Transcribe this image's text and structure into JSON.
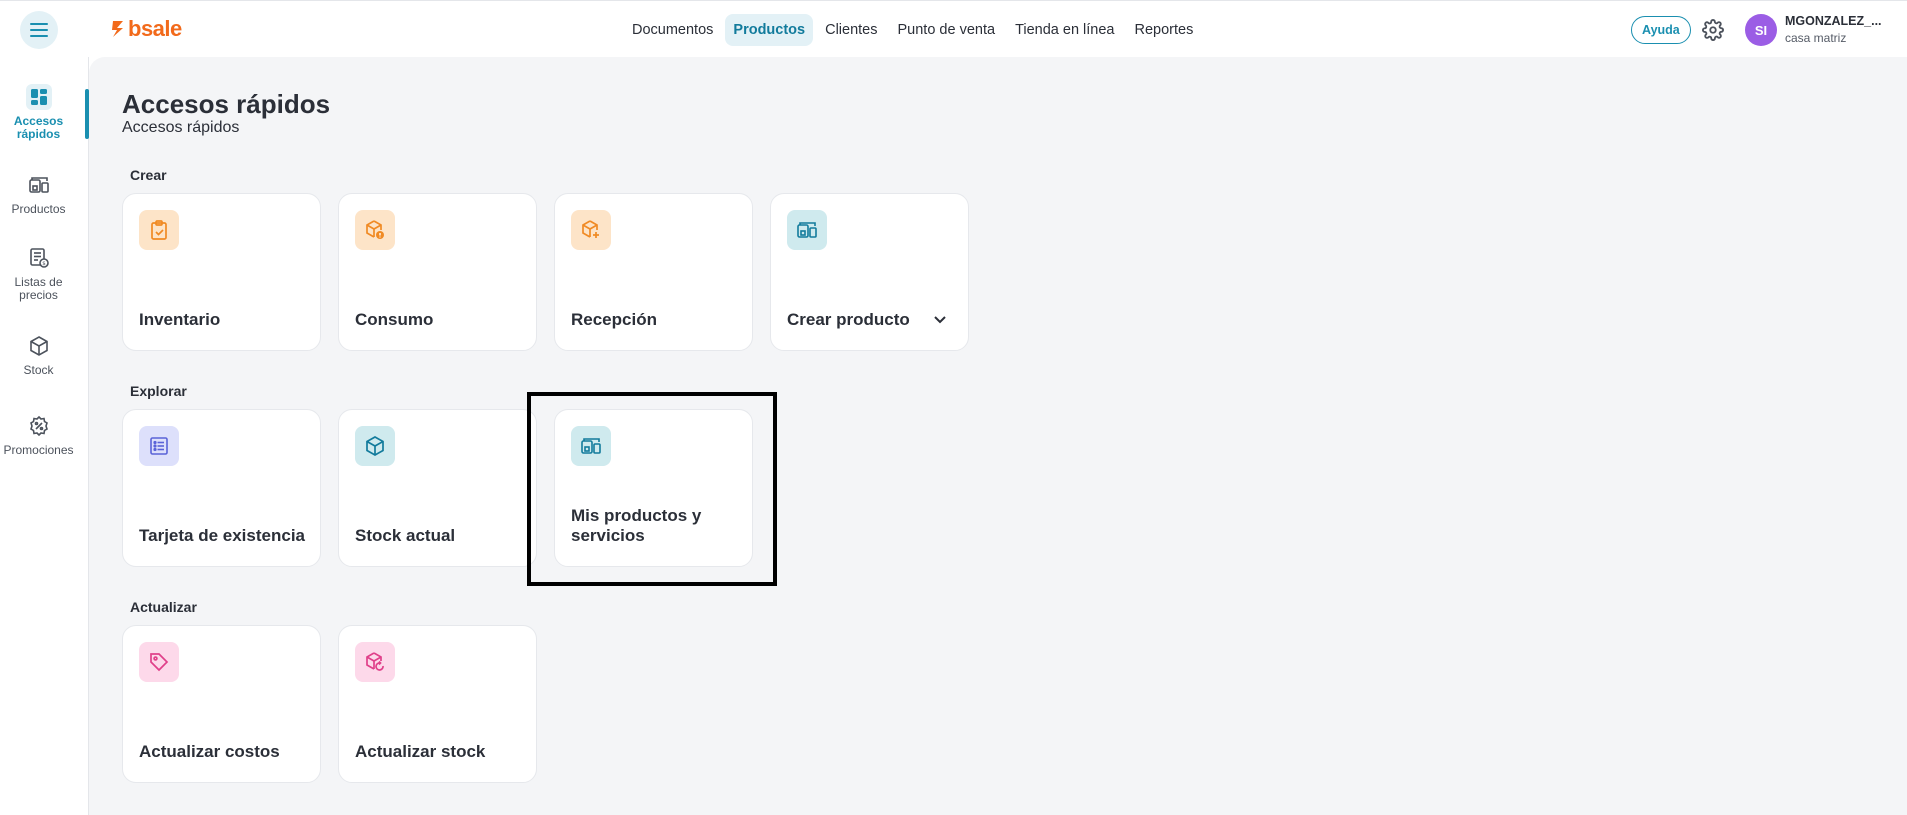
{
  "header": {
    "logo_text": "bsale",
    "nav": [
      {
        "label": "Documentos",
        "active": false
      },
      {
        "label": "Productos",
        "active": true
      },
      {
        "label": "Clientes",
        "active": false
      },
      {
        "label": "Punto de venta",
        "active": false
      },
      {
        "label": "Tienda en línea",
        "active": false
      },
      {
        "label": "Reportes",
        "active": false
      }
    ],
    "help_label": "Ayuda",
    "user": {
      "initials": "SI",
      "name": "MGONZALEZ_...",
      "branch": "casa matriz"
    }
  },
  "sidebar": {
    "items": [
      {
        "label": "Accesos\nrápidos",
        "icon": "dashboard-icon",
        "active": true
      },
      {
        "label": "Productos",
        "icon": "products-icon",
        "active": false
      },
      {
        "label": "Listas de\nprecios",
        "icon": "price-list-icon",
        "active": false
      },
      {
        "label": "Stock",
        "icon": "box-icon",
        "active": false
      },
      {
        "label": "Promociones",
        "icon": "promo-icon",
        "active": false
      }
    ]
  },
  "main": {
    "title": "Accesos rápidos",
    "subtitle": "Accesos rápidos",
    "sections": {
      "crear": {
        "label": "Crear",
        "cards": [
          {
            "title": "Inventario",
            "icon": "clipboard-check-icon"
          },
          {
            "title": "Consumo",
            "icon": "box-alert-icon"
          },
          {
            "title": "Recepción",
            "icon": "box-plus-icon"
          },
          {
            "title": "Crear producto",
            "icon": "products-icon"
          }
        ]
      },
      "explorar": {
        "label": "Explorar",
        "cards": [
          {
            "title": "Tarjeta de existencia",
            "icon": "list-card-icon"
          },
          {
            "title": "Stock actual",
            "icon": "box-icon"
          },
          {
            "title": "Mis productos y servicios",
            "icon": "products-icon"
          }
        ]
      },
      "actualizar": {
        "label": "Actualizar",
        "cards": [
          {
            "title": "Actualizar costos",
            "icon": "tag-icon"
          },
          {
            "title": "Actualizar stock",
            "icon": "box-refresh-icon"
          }
        ]
      }
    }
  },
  "colors": {
    "brand_orange": "#f26a1b",
    "accent_teal": "#1a8fb0",
    "avatar_purple": "#9b5de5"
  }
}
